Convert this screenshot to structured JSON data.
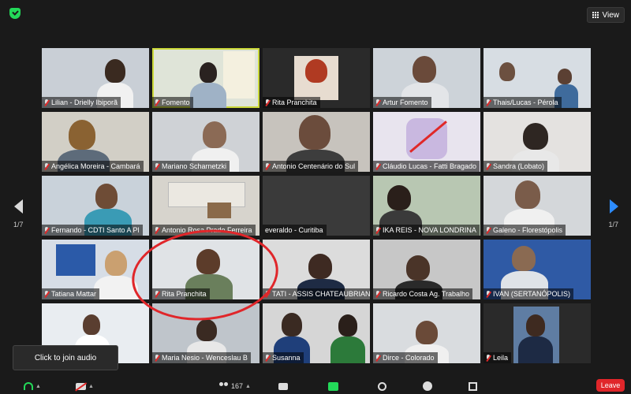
{
  "topbar": {
    "view_label": "View"
  },
  "pagination": {
    "left": "1/7",
    "right": "1/7"
  },
  "tiles": [
    {
      "name": "Lilian - Drielly Ibiporã"
    },
    {
      "name": "Fomento"
    },
    {
      "name": "Rita Pranchita"
    },
    {
      "name": "Artur Fomento"
    },
    {
      "name": "Thais/Lucas - Pérola"
    },
    {
      "name": "Angélica Moreira - Cambará"
    },
    {
      "name": "Mariano Scharnetzki"
    },
    {
      "name": "Antonio Centenário do Sul"
    },
    {
      "name": "Cláudio Lucas - Fatti Bragado"
    },
    {
      "name": "Sandra (Lobato)"
    },
    {
      "name": "Fernando - CDTI Santo A Pl"
    },
    {
      "name": "Antonio Rosa Prado Ferreira"
    },
    {
      "name": "everaldo - Curitiba"
    },
    {
      "name": "IKA REIS - NOVA LONDRINA"
    },
    {
      "name": "Galeno - Florestópolis"
    },
    {
      "name": "Tatiana Mattar"
    },
    {
      "name": "Rita Pranchita"
    },
    {
      "name": "TATI - ASSIS CHATEAUBRIAND"
    },
    {
      "name": "Ricardo Costa Ag. Trabalho"
    },
    {
      "name": "IVAN (SERTANÓPOLIS)"
    },
    {
      "name": ""
    },
    {
      "name": "Maria Nesio - Wenceslau B"
    },
    {
      "name": "Susanna"
    },
    {
      "name": "Dirce - Colorado"
    },
    {
      "name": "Leila"
    }
  ],
  "tooltip": {
    "text": "Click to join audio"
  },
  "toolbar": {
    "participants_count": "167",
    "leave_label": "Leave"
  },
  "colors": {
    "active_speaker": "#cbd93a",
    "annotation_circle": "#e0262a",
    "leave": "#e0262a",
    "nav_arrow": "#2d8cff"
  }
}
